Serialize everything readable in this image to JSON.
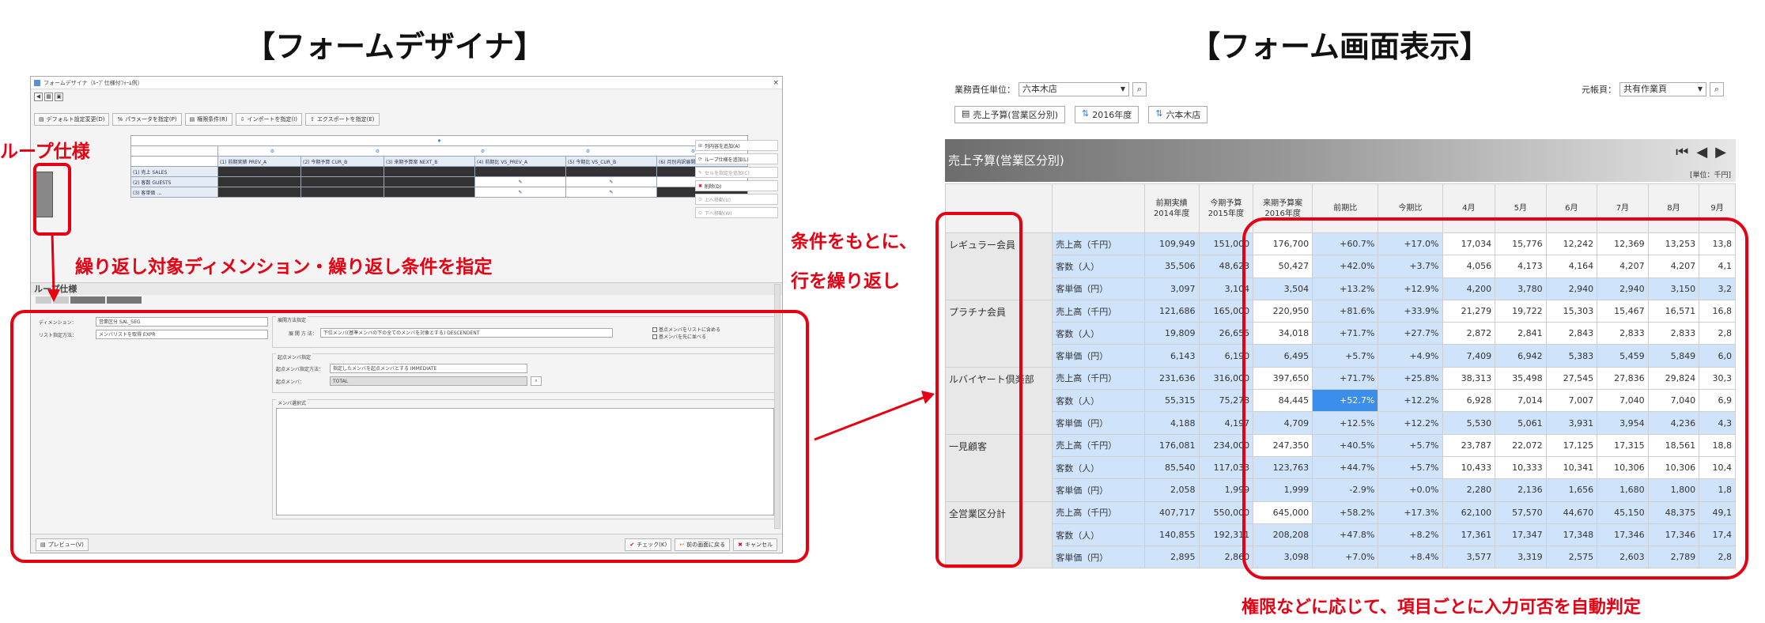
{
  "headings": {
    "designer": "【フォームデザイナ】",
    "display": "【フォーム画面表示】"
  },
  "annotations": {
    "loop_spec": "ループ仕様",
    "repeat_target": "繰り返し対象ディメンション・繰り返し条件を指定",
    "condition_line1": "条件をもとに、",
    "condition_line2": "行を繰り返し",
    "auto_judge": "権限などに応じて、項目ごとに入力可否を自動判定"
  },
  "designer": {
    "window_title": "フォームデザイナ（ﾙｰﾌﾟ仕様付ﾌｫｰﾑ例）",
    "close": "×",
    "toolbar": [
      "デフォルト設定変更(D)",
      "パラメータを指定(P)",
      "権限条件(R)",
      "インポートを指定(I)",
      "エクスポートを指定(E)"
    ],
    "col_headers": [
      "(1) 前期実績 PREV_A",
      "(2) 今期予算 CUR_B",
      "(3) 来期予算案 NEXT_B",
      "(4) 前期比 VS_PREV_A",
      "(5) 今期比 VS_CUR_B",
      "(6) 月別内訳展開 MONTHLY"
    ],
    "row_labels": [
      "(1) 売上 SALES",
      "(2) 客数 GUESTS",
      "(3) 客単価 …"
    ],
    "side_buttons": [
      "列内容を追加(A)",
      "ループ仕様を追加(L)",
      "セルを指定を追加(C)",
      "削除(D)",
      "上へ移動(U)",
      "下へ移動(W)"
    ],
    "section_title": "ループ仕様",
    "dimension_label": "ディメンション：",
    "dimension_value": "営業区分 SAL_SEG",
    "list_method_label": "リスト指定方法：",
    "list_method_value": "メンバリストを取得 EXPR",
    "expand_group": "展開方法指定",
    "expand_label": "展 開 方 法：",
    "expand_value": "下位メンバ(基準メンバの下の全てのメンバを対象とする) DESCENDENT",
    "chk1": "基点メンバをリストに含める",
    "chk2": "基メンバを先に並べる",
    "base_group": "起点メンバ指定",
    "base_method_label": "起点メンバ指定方法：",
    "base_method_value": "指定したメンバを起点メンバとする IMMEDIATE",
    "base_member_label": "起点メンバ：",
    "base_member_value": "TOTAL",
    "member_expr": "メンバ選択式",
    "preview_button": "プレビュー(V)",
    "footer_buttons": [
      "チェック(K)",
      "前の画面に戻る",
      "キャンセル"
    ]
  },
  "form": {
    "unit_label": "業務責任単位：",
    "unit_value": "六本木店",
    "scenario_label": "元帳頁：",
    "scenario_value": "共有作業頁",
    "tags": [
      "売上予算(営業区分別)",
      "2016年度",
      "六本木店"
    ],
    "banner_title": "売上予算(営業区分別)",
    "unit_note": "[単位：千円]",
    "columns": [
      "前期実績\n2014年度",
      "今期予算\n2015年度",
      "来期予算案\n2016年度",
      "前期比",
      "今期比",
      "4月",
      "5月",
      "6月",
      "7月",
      "8月",
      "9月"
    ],
    "groups": [
      {
        "name": "レギュラー会員",
        "rows": [
          {
            "label": "売上高（千円）",
            "values": [
              "109,949",
              "151,000",
              "176,700",
              "+60.7%",
              "+17.0%",
              "17,034",
              "15,776",
              "12,242",
              "12,369",
              "13,253",
              "13,8"
            ]
          },
          {
            "label": "客数（人）",
            "values": [
              "35,506",
              "48,623",
              "50,427",
              "+42.0%",
              "+3.7%",
              "4,056",
              "4,173",
              "4,164",
              "4,207",
              "4,207",
              "4,1"
            ]
          },
          {
            "label": "客単価（円）",
            "values": [
              "3,097",
              "3,104",
              "3,504",
              "+13.2%",
              "+12.9%",
              "4,200",
              "3,780",
              "2,940",
              "2,940",
              "3,150",
              "3,2"
            ]
          }
        ]
      },
      {
        "name": "プラチナ会員",
        "rows": [
          {
            "label": "売上高（千円）",
            "values": [
              "121,686",
              "165,000",
              "220,950",
              "+81.6%",
              "+33.9%",
              "21,279",
              "19,722",
              "15,303",
              "15,467",
              "16,571",
              "16,8"
            ]
          },
          {
            "label": "客数（人）",
            "values": [
              "19,809",
              "26,655",
              "34,018",
              "+71.7%",
              "+27.7%",
              "2,872",
              "2,841",
              "2,843",
              "2,833",
              "2,833",
              "2,8"
            ]
          },
          {
            "label": "客単価（円）",
            "values": [
              "6,143",
              "6,190",
              "6,495",
              "+5.7%",
              "+4.9%",
              "7,409",
              "6,942",
              "5,383",
              "5,459",
              "5,849",
              "6,0"
            ]
          }
        ]
      },
      {
        "name": "ルバイヤート倶楽部",
        "rows": [
          {
            "label": "売上高（千円）",
            "values": [
              "231,636",
              "316,000",
              "397,650",
              "+71.7%",
              "+25.8%",
              "38,313",
              "35,498",
              "27,545",
              "27,836",
              "29,824",
              "30,3"
            ]
          },
          {
            "label": "客数（人）",
            "values": [
              "55,315",
              "75,278",
              "84,445",
              "+52.7%",
              "+12.2%",
              "6,928",
              "7,014",
              "7,007",
              "7,040",
              "7,040",
              "6,9"
            ]
          },
          {
            "label": "客単価（円）",
            "values": [
              "4,188",
              "4,197",
              "4,709",
              "+12.5%",
              "+12.2%",
              "5,530",
              "5,061",
              "3,931",
              "3,954",
              "4,236",
              "4,3"
            ]
          }
        ]
      },
      {
        "name": "一見顧客",
        "rows": [
          {
            "label": "売上高（千円）",
            "values": [
              "176,081",
              "234,000",
              "247,350",
              "+40.5%",
              "+5.7%",
              "23,787",
              "22,072",
              "17,125",
              "17,315",
              "18,561",
              "18,8"
            ]
          },
          {
            "label": "客数（人）",
            "values": [
              "85,540",
              "117,033",
              "123,763",
              "+44.7%",
              "+5.7%",
              "10,433",
              "10,333",
              "10,341",
              "10,306",
              "10,306",
              "10,4"
            ]
          },
          {
            "label": "客単価（円）",
            "values": [
              "2,058",
              "1,999",
              "1,999",
              "-2.9%",
              "+0.0%",
              "2,280",
              "2,136",
              "1,656",
              "1,680",
              "1,800",
              "1,8"
            ]
          }
        ]
      },
      {
        "name": "全営業区分計",
        "rows": [
          {
            "label": "売上高（千円）",
            "values": [
              "407,717",
              "550,000",
              "645,000",
              "+58.2%",
              "+17.3%",
              "62,100",
              "57,570",
              "44,670",
              "45,150",
              "48,375",
              "49,1"
            ]
          },
          {
            "label": "客数（人）",
            "values": [
              "140,855",
              "192,311",
              "208,208",
              "+47.8%",
              "+8.2%",
              "17,361",
              "17,347",
              "17,348",
              "17,346",
              "17,346",
              "17,4"
            ]
          },
          {
            "label": "客単価（円）",
            "values": [
              "2,895",
              "2,860",
              "3,098",
              "+7.0%",
              "+8.4%",
              "3,577",
              "3,319",
              "2,575",
              "2,603",
              "2,789",
              "2,8"
            ]
          }
        ]
      }
    ]
  }
}
